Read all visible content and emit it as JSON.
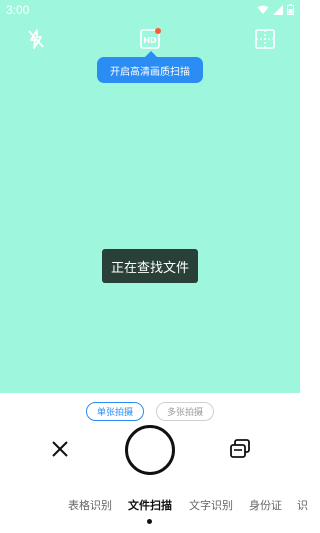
{
  "status_bar": {
    "time": "3:00",
    "icons": [
      "wifi-icon",
      "signal-icon",
      "battery-icon"
    ]
  },
  "toolbar": {
    "flash_icon": "flash-off-icon",
    "hd_icon": "hd-icon",
    "grid_icon": "grid-icon",
    "hd_badge_color": "#ff5a36"
  },
  "tooltip": {
    "text": "开启高清画质扫描"
  },
  "toast": {
    "text": "正在查找文件"
  },
  "capture_modes": {
    "single": "单张拍摄",
    "multi": "多张拍摄",
    "selected": "单张拍摄"
  },
  "controls": {
    "close_icon": "close-icon",
    "shutter": "shutter-button",
    "gallery_icon": "gallery-icon"
  },
  "scan_tabs": {
    "items": [
      "表格识别",
      "文件扫描",
      "文字识别",
      "身份证",
      "识"
    ],
    "active": "文件扫描"
  },
  "colors": {
    "camera_bg": "#9ef7dc",
    "accent": "#2b8cf3",
    "toast_bg": "#284038"
  }
}
